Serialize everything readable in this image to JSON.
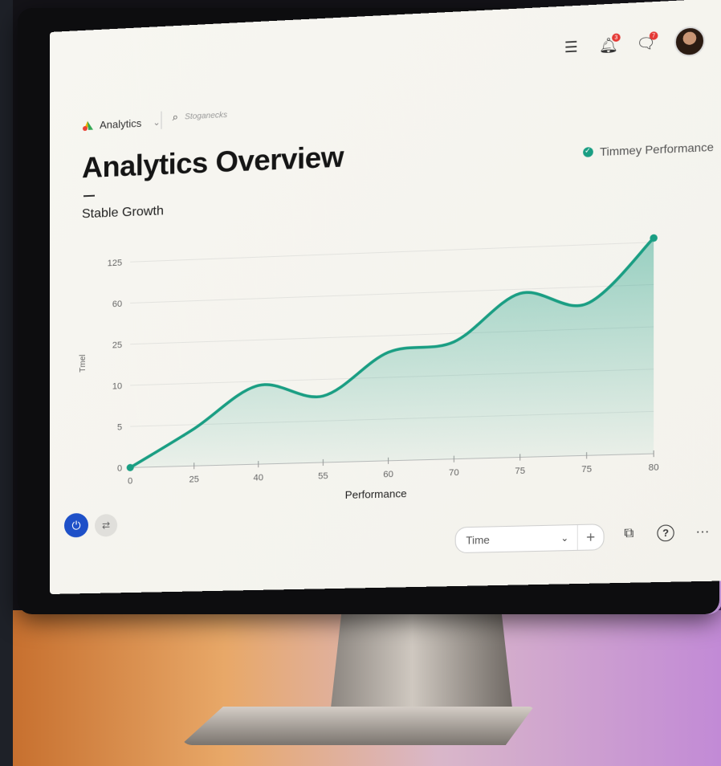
{
  "brand": {
    "name": "Analytics"
  },
  "search": {
    "placeholder": "Stoganecks"
  },
  "notifications": {
    "bell_count": "3",
    "messages_count": "7"
  },
  "page": {
    "title": "Analytics Overview",
    "subtitle": "Stable Growth"
  },
  "legend": {
    "label": "Timmey Performance"
  },
  "footer": {
    "time_select_value": "Time",
    "add_label": "+"
  },
  "colors": {
    "accent": "#1a9e83",
    "power_button": "#1e50c8"
  },
  "icons": [
    "menu-icon",
    "bell-icon",
    "message-icon",
    "search-icon",
    "power-icon",
    "swap-icon",
    "chat-icon",
    "help-icon",
    "more-icon"
  ],
  "chart_data": {
    "type": "area",
    "title": "",
    "xlabel": "Performance",
    "ylabel": "Tmel",
    "x_tick_labels": [
      "0",
      "25",
      "40",
      "55",
      "60",
      "70",
      "75",
      "75",
      "80"
    ],
    "y_tick_labels": [
      "0",
      "5",
      "10",
      "25",
      "60",
      "125"
    ],
    "series": [
      {
        "name": "Timmey Performance",
        "x": [
          0,
          1,
          2,
          3,
          4,
          5,
          6,
          7,
          8
        ],
        "values": [
          0.0,
          0.9,
          1.9,
          1.6,
          2.6,
          2.8,
          3.9,
          3.6,
          5.1
        ]
      }
    ],
    "grid": true,
    "legend_position": "top-right"
  }
}
